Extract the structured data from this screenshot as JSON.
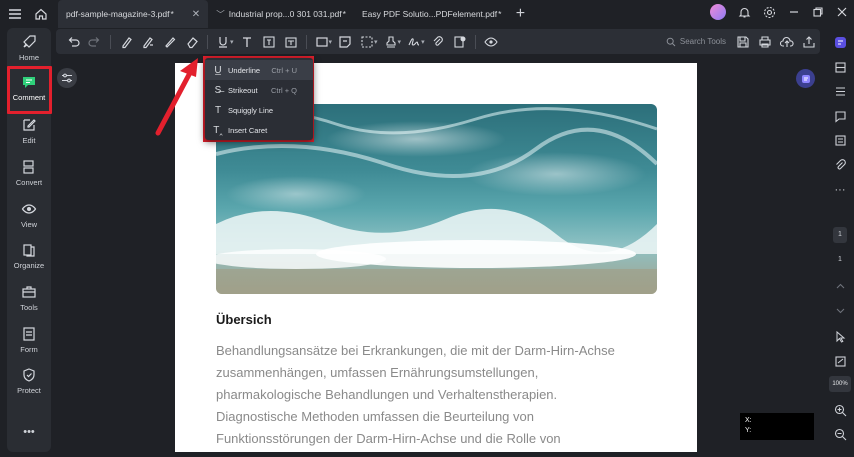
{
  "titlebar": {
    "tabs": [
      {
        "label": "pdf-sample-magazine-3.pdf",
        "modified": "*",
        "active": true
      },
      {
        "label": "Industrial  prop...0 301 031.pdf",
        "modified": "*",
        "active": false
      },
      {
        "label": "Easy PDF Solutio...PDFelement.pdf",
        "modified": "*",
        "active": false
      }
    ],
    "add_tab_icon": "plus-icon"
  },
  "leftnav": {
    "items": [
      {
        "label": "Home",
        "icon": "rocket-icon"
      },
      {
        "label": "Comment",
        "icon": "comment-icon"
      },
      {
        "label": "Edit",
        "icon": "edit-icon"
      },
      {
        "label": "Convert",
        "icon": "convert-icon"
      },
      {
        "label": "View",
        "icon": "eye-icon"
      },
      {
        "label": "Organize",
        "icon": "organize-icon"
      },
      {
        "label": "Tools",
        "icon": "toolbox-icon"
      },
      {
        "label": "Form",
        "icon": "form-icon"
      },
      {
        "label": "Protect",
        "icon": "shield-icon"
      },
      {
        "label": "•••",
        "icon": "more-icon"
      }
    ],
    "active": "Comment"
  },
  "toolbar": {
    "search_placeholder": "Search Tools"
  },
  "dropdown": {
    "items": [
      {
        "label": "Underline",
        "shortcut": "Ctrl + U",
        "icon": "underline-icon"
      },
      {
        "label": "Strikeout",
        "shortcut": "Ctrl + Q",
        "icon": "strikeout-icon"
      },
      {
        "label": "Squiggly Line",
        "shortcut": "",
        "icon": "squiggly-icon"
      },
      {
        "label": "Insert Caret",
        "shortcut": "",
        "icon": "caret-insert-icon"
      }
    ]
  },
  "document": {
    "heading": "Übersich",
    "text_lines": [
      "Behandlungsansätze bei Erkrankungen, die mit der Darm-Hirn-Achse",
      "zusammenhängen, umfassen Ernährungsumstellungen,",
      "pharmakologische Behandlungen und Verhaltenstherapien.",
      "Diagnostische Methoden umfassen die Beurteilung von",
      "Funktionsstörungen der Darm-Hirn-Achse und die Rolle von"
    ]
  },
  "rightbar": {
    "page_current": "1",
    "page_total": "1",
    "zoom": "100%"
  },
  "coords": {
    "x_label": "X:",
    "y_label": "Y:"
  },
  "colors": {
    "highlight": "#e3202d",
    "accent": "#3b3f8f"
  }
}
